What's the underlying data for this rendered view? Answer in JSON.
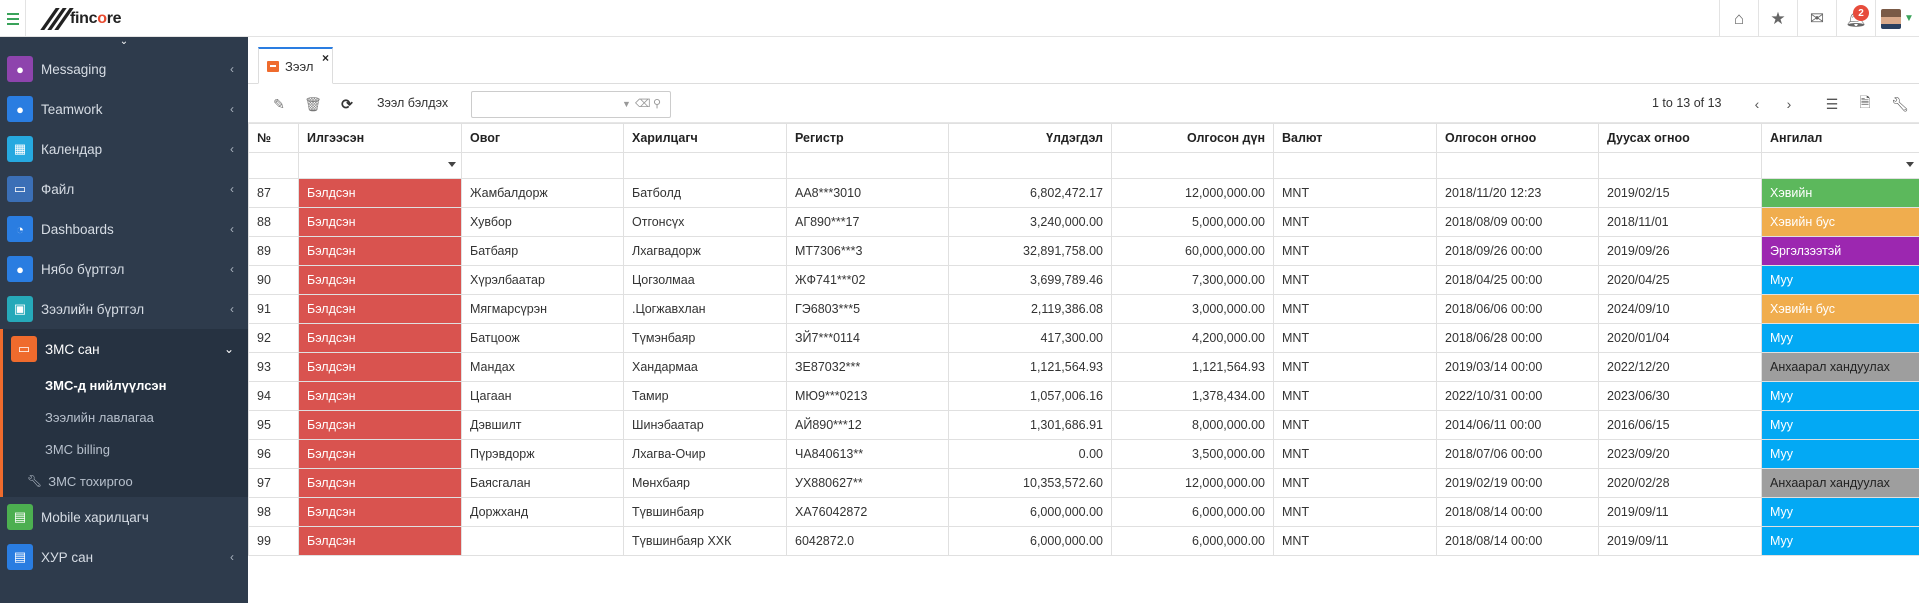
{
  "app": {
    "logo_text_a": "finc",
    "logo_text_b": "o",
    "logo_text_c": "re",
    "notification_count": "2"
  },
  "topbar": {
    "icons": [
      "home-icon",
      "star-icon",
      "envelope-icon",
      "bell-icon"
    ]
  },
  "sidebar": {
    "items": [
      {
        "label": "Messaging",
        "color": "#8e44ad"
      },
      {
        "label": "Teamwork",
        "color": "#2a7de1"
      },
      {
        "label": "Календар",
        "color": "#26a9e0"
      },
      {
        "label": "Файл",
        "color": "#3b6fb6"
      },
      {
        "label": "Dashboards",
        "color": "#2a7de1"
      },
      {
        "label": "Нябо бүртгэл",
        "color": "#2a7de1"
      },
      {
        "label": "Зээлийн бүртгэл",
        "color": "#26a9b9"
      },
      {
        "label": "ЗМС сан",
        "color": "#ef6b2d"
      },
      {
        "label": "Mobile харилцагч",
        "color": "#4caf50"
      },
      {
        "label": "ХУР сан",
        "color": "#2a7de1"
      }
    ],
    "sub_items": [
      {
        "label": "ЗМС-д нийлүүлсэн"
      },
      {
        "label": "Зээлийн лавлагаа"
      },
      {
        "label": "ЗМС billing"
      },
      {
        "label": "ЗМС тохиргоо"
      }
    ]
  },
  "tab": {
    "label": "Зээл",
    "close": "×"
  },
  "toolbar": {
    "search_label": "Зээл бэлдэх",
    "search_placeholder": "",
    "pager": "1 to 13 of 13"
  },
  "table": {
    "headers": [
      "№",
      "Илгээсэн",
      "Овог",
      "Харилцагч",
      "Регистр",
      "Үлдэгдэл",
      "Олгосон дүн",
      "Валют",
      "Олгосон огноо",
      "Дуусах огноо",
      "Ангилал"
    ],
    "rows": [
      {
        "no": "87",
        "status": "Бэлдсэн",
        "surname": "Жамбалдорж",
        "client": "Батболд",
        "reg": "АА8***3010",
        "balance": "6,802,472.17",
        "amount": "12,000,000.00",
        "cur": "MNT",
        "issued": "2018/11/20 12:23",
        "due": "2019/02/15",
        "cat": "Хэвийн",
        "cat_class": "cat-green"
      },
      {
        "no": "88",
        "status": "Бэлдсэн",
        "surname": "Хувбор",
        "client": "Отгонсүх",
        "reg": "АГ890***17",
        "balance": "3,240,000.00",
        "amount": "5,000,000.00",
        "cur": "MNT",
        "issued": "2018/08/09 00:00",
        "due": "2018/11/01",
        "cat": "Хэвийн бус",
        "cat_class": "cat-orange"
      },
      {
        "no": "89",
        "status": "Бэлдсэн",
        "surname": "Батбаяр",
        "client": "Лхагвадорж",
        "reg": "МТ7306***3",
        "balance": "32,891,758.00",
        "amount": "60,000,000.00",
        "cur": "MNT",
        "issued": "2018/09/26 00:00",
        "due": "2019/09/26",
        "cat": "Эргэлзээтэй",
        "cat_class": "cat-purple"
      },
      {
        "no": "90",
        "status": "Бэлдсэн",
        "surname": "Хүрэлбаатар",
        "client": "Цогзолмаа",
        "reg": "ЖФ741***02",
        "balance": "3,699,789.46",
        "amount": "7,300,000.00",
        "cur": "MNT",
        "issued": "2018/04/25 00:00",
        "due": "2020/04/25",
        "cat": "Муу",
        "cat_class": "cat-blue"
      },
      {
        "no": "91",
        "status": "Бэлдсэн",
        "surname": "Мягмарсүрэн",
        "client": ".Цогжавхлан",
        "reg": "ГЭ6803***5",
        "balance": "2,119,386.08",
        "amount": "3,000,000.00",
        "cur": "MNT",
        "issued": "2018/06/06 00:00",
        "due": "2024/09/10",
        "cat": "Хэвийн бус",
        "cat_class": "cat-orange"
      },
      {
        "no": "92",
        "status": "Бэлдсэн",
        "surname": "Батцоож",
        "client": "Түмэнбаяр",
        "reg": "ЗЙ7***0114",
        "balance": "417,300.00",
        "amount": "4,200,000.00",
        "cur": "MNT",
        "issued": "2018/06/28 00:00",
        "due": "2020/01/04",
        "cat": "Муу",
        "cat_class": "cat-blue"
      },
      {
        "no": "93",
        "status": "Бэлдсэн",
        "surname": "Мандах",
        "client": "Хандармаа",
        "reg": "ЗЕ87032***",
        "balance": "1,121,564.93",
        "amount": "1,121,564.93",
        "cur": "MNT",
        "issued": "2019/03/14 00:00",
        "due": "2022/12/20",
        "cat": "Анхаарал хандуулах",
        "cat_class": "cat-gray"
      },
      {
        "no": "94",
        "status": "Бэлдсэн",
        "surname": "Цагаан",
        "client": "Тамир",
        "reg": "МЮ9***0213",
        "balance": "1,057,006.16",
        "amount": "1,378,434.00",
        "cur": "MNT",
        "issued": "2022/10/31 00:00",
        "due": "2023/06/30",
        "cat": "Муу",
        "cat_class": "cat-blue"
      },
      {
        "no": "95",
        "status": "Бэлдсэн",
        "surname": "Дэвшилт",
        "client": "Шинэбаатар",
        "reg": "АЙ890***12",
        "balance": "1,301,686.91",
        "amount": "8,000,000.00",
        "cur": "MNT",
        "issued": "2014/06/11 00:00",
        "due": "2016/06/15",
        "cat": "Муу",
        "cat_class": "cat-blue"
      },
      {
        "no": "96",
        "status": "Бэлдсэн",
        "surname": "Пүрэвдорж",
        "client": "Лхагва-Очир",
        "reg": "ЧА840613**",
        "balance": "0.00",
        "amount": "3,500,000.00",
        "cur": "MNT",
        "issued": "2018/07/06 00:00",
        "due": "2023/09/20",
        "cat": "Муу",
        "cat_class": "cat-blue"
      },
      {
        "no": "97",
        "status": "Бэлдсэн",
        "surname": "Баясгалан",
        "client": "Мөнхбаяр",
        "reg": "УХ880627**",
        "balance": "10,353,572.60",
        "amount": "12,000,000.00",
        "cur": "MNT",
        "issued": "2019/02/19 00:00",
        "due": "2020/02/28",
        "cat": "Анхаарал хандуулах",
        "cat_class": "cat-gray"
      },
      {
        "no": "98",
        "status": "Бэлдсэн",
        "surname": "Доржханд",
        "client": "Түвшинбаяр",
        "reg": "ХА76042872",
        "balance": "6,000,000.00",
        "amount": "6,000,000.00",
        "cur": "MNT",
        "issued": "2018/08/14 00:00",
        "due": "2019/09/11",
        "cat": "Муу",
        "cat_class": "cat-blue"
      },
      {
        "no": "99",
        "status": "Бэлдсэн",
        "surname": "",
        "client": "Түвшинбаяр ХХК",
        "reg": "6042872.0",
        "balance": "6,000,000.00",
        "amount": "6,000,000.00",
        "cur": "MNT",
        "issued": "2018/08/14 00:00",
        "due": "2019/09/11",
        "cat": "Муу",
        "cat_class": "cat-blue"
      }
    ]
  }
}
